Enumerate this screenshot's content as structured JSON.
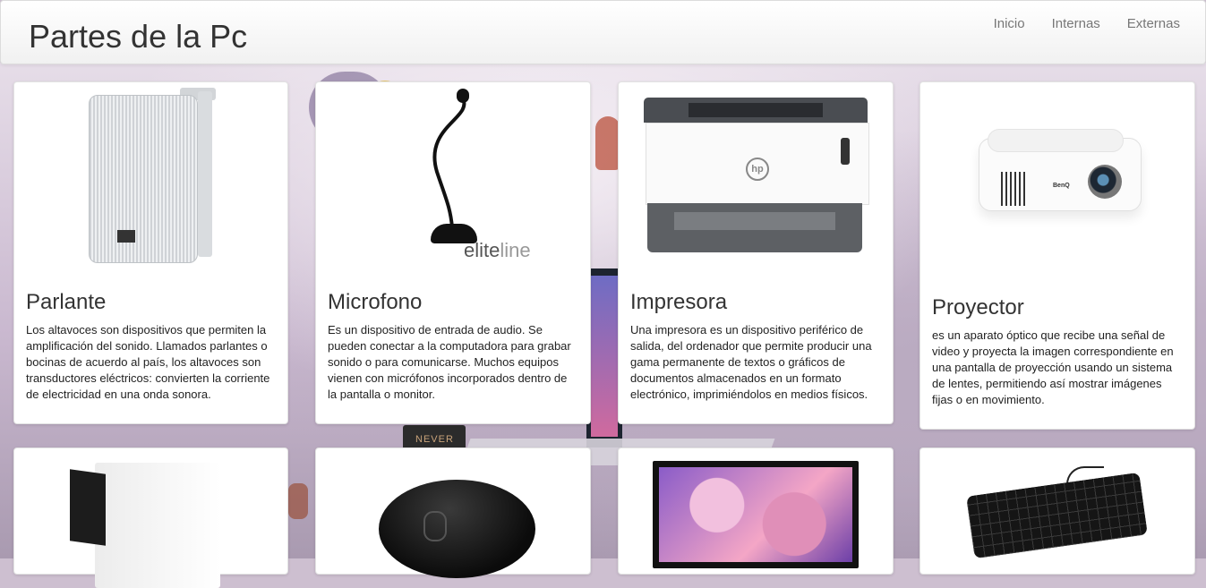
{
  "navbar": {
    "brand": "Partes de la Pc",
    "links": [
      "Inicio",
      "Internas",
      "Externas"
    ]
  },
  "cards": [
    {
      "image_icon": "speaker-image",
      "title": "Parlante",
      "text": "Los altavoces son dispositivos que permiten la amplificación del sonido. Llamados parlantes o bocinas de acuerdo al país, los altavoces son transductores eléctricos: convierten la corriente de electricidad en una onda sonora."
    },
    {
      "image_icon": "microphone-image",
      "image_brand": "elite",
      "image_brand_light": "line",
      "title": "Microfono",
      "text": "Es un dispositivo de entrada de audio. Se pueden conectar a la computadora para grabar sonido o para comunicarse. Muchos equipos vienen con micrófonos incorporados dentro de la pantalla o monitor."
    },
    {
      "image_icon": "printer-image",
      "title": "Impresora",
      "text": "Una impresora es un dispositivo periférico de salida, del ordenador que permite producir una gama permanente de textos o gráficos de documentos almacenados en un formato electrónico, imprimiéndolos en medios físicos."
    },
    {
      "image_icon": "projector-image",
      "image_brand": "BenQ",
      "title": "Proyector",
      "text": "es un aparato óptico que recibe una señal de video y proyecta la imagen correspondiente en una pantalla de proyección usando un sistema de lentes, permitiendo así mostrar imágenes fijas o en movimiento."
    },
    {
      "image_icon": "computer-case-image"
    },
    {
      "image_icon": "mouse-image"
    },
    {
      "image_icon": "monitor-image"
    },
    {
      "image_icon": "keyboard-image"
    }
  ],
  "background": {
    "mug_text": "NEVER"
  }
}
